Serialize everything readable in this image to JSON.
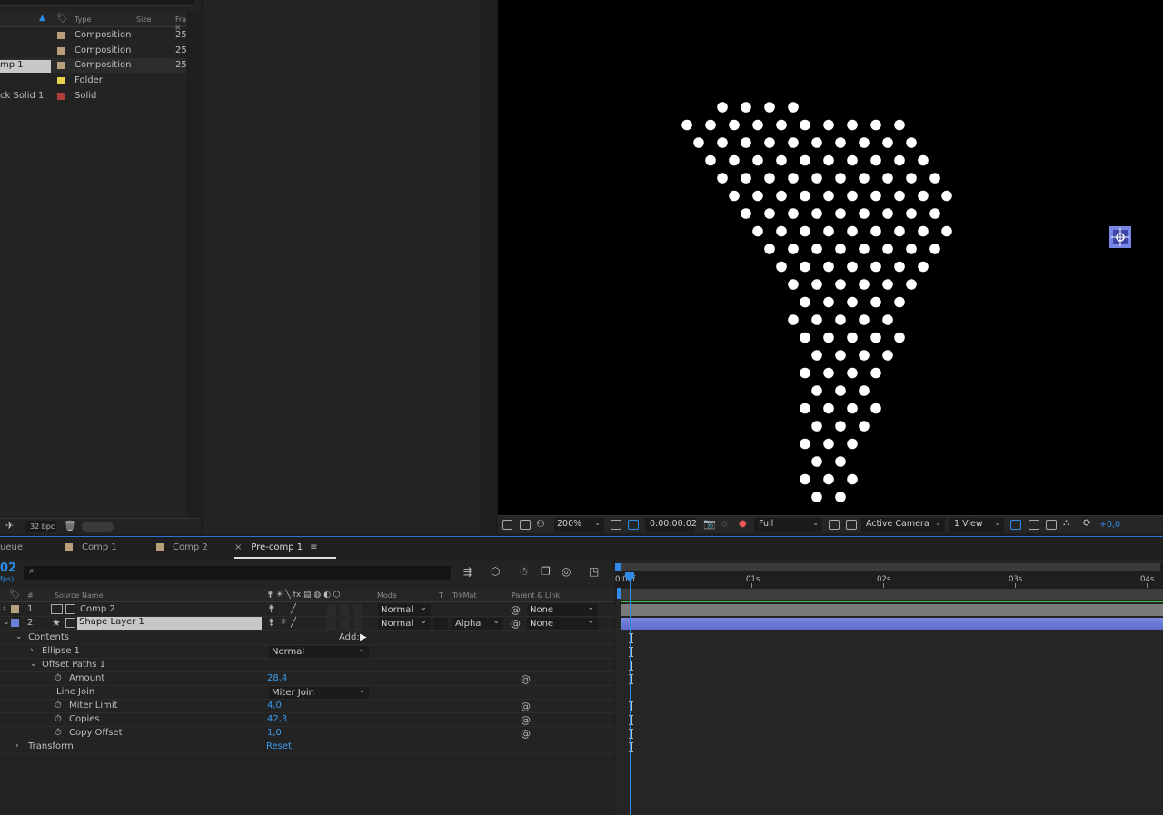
{
  "project": {
    "columns": {
      "type": "Type",
      "size": "Size",
      "frame": "Frame R"
    },
    "items": [
      {
        "name": "",
        "type": "Composition",
        "frame": "25",
        "color": "#b7a07a",
        "selected": false
      },
      {
        "name": "",
        "type": "Composition",
        "frame": "25",
        "color": "#b7a07a",
        "selected": false
      },
      {
        "name": "mp 1",
        "type": "Composition",
        "frame": "25",
        "color": "#b7a07a",
        "selected": true
      },
      {
        "name": "",
        "type": "Folder",
        "frame": "",
        "color": "#e6d24b",
        "selected": false
      },
      {
        "name": "ck Solid 1",
        "type": "Solid",
        "frame": "",
        "color": "#b23b3b",
        "selected": false
      }
    ],
    "bpc": "32 bpc"
  },
  "viewer_bar": {
    "zoom": "200%",
    "timecode": "0:00:00:02",
    "resolution": "Full",
    "camera": "Active Camera",
    "views": "1 View",
    "exposure": "+0,0"
  },
  "tabs": {
    "render_queue": "ueue",
    "comp1": "Comp 1",
    "comp2": "Comp 2",
    "precomp": "Pre-comp 1"
  },
  "timeline": {
    "time": "02",
    "fps": "fps)",
    "columns": {
      "num": "#",
      "source": "Source Name",
      "mode": "Mode",
      "t": "T",
      "trkmat": "TrkMat",
      "parent": "Parent & Link"
    },
    "layers": [
      {
        "num": "1",
        "name": "Comp 2",
        "mode": "Normal",
        "trkmat": "",
        "parent": "None",
        "color": "#b7a07a"
      },
      {
        "num": "2",
        "name": "Shape Layer 1",
        "mode": "Normal",
        "trkmat": "Alpha",
        "parent": "None",
        "color": "#6b7fd6"
      }
    ],
    "props": {
      "contents": "Contents",
      "add": "Add:",
      "ellipse": "Ellipse 1",
      "ellipse_mode": "Normal",
      "offset_paths": "Offset Paths 1",
      "amount_label": "Amount",
      "amount": "28,4",
      "line_join_label": "Line Join",
      "line_join": "Miter Join",
      "miter_label": "Miter Limit",
      "miter": "4,0",
      "copies_label": "Copies",
      "copies": "42,3",
      "copy_offset_label": "Copy Offset",
      "copy_offset": "1,0",
      "transform": "Transform",
      "reset": "Reset"
    },
    "ruler": {
      "t0": "0:00f",
      "t1": "01s",
      "t2": "02s",
      "t3": "03s",
      "t4": "04s"
    }
  }
}
